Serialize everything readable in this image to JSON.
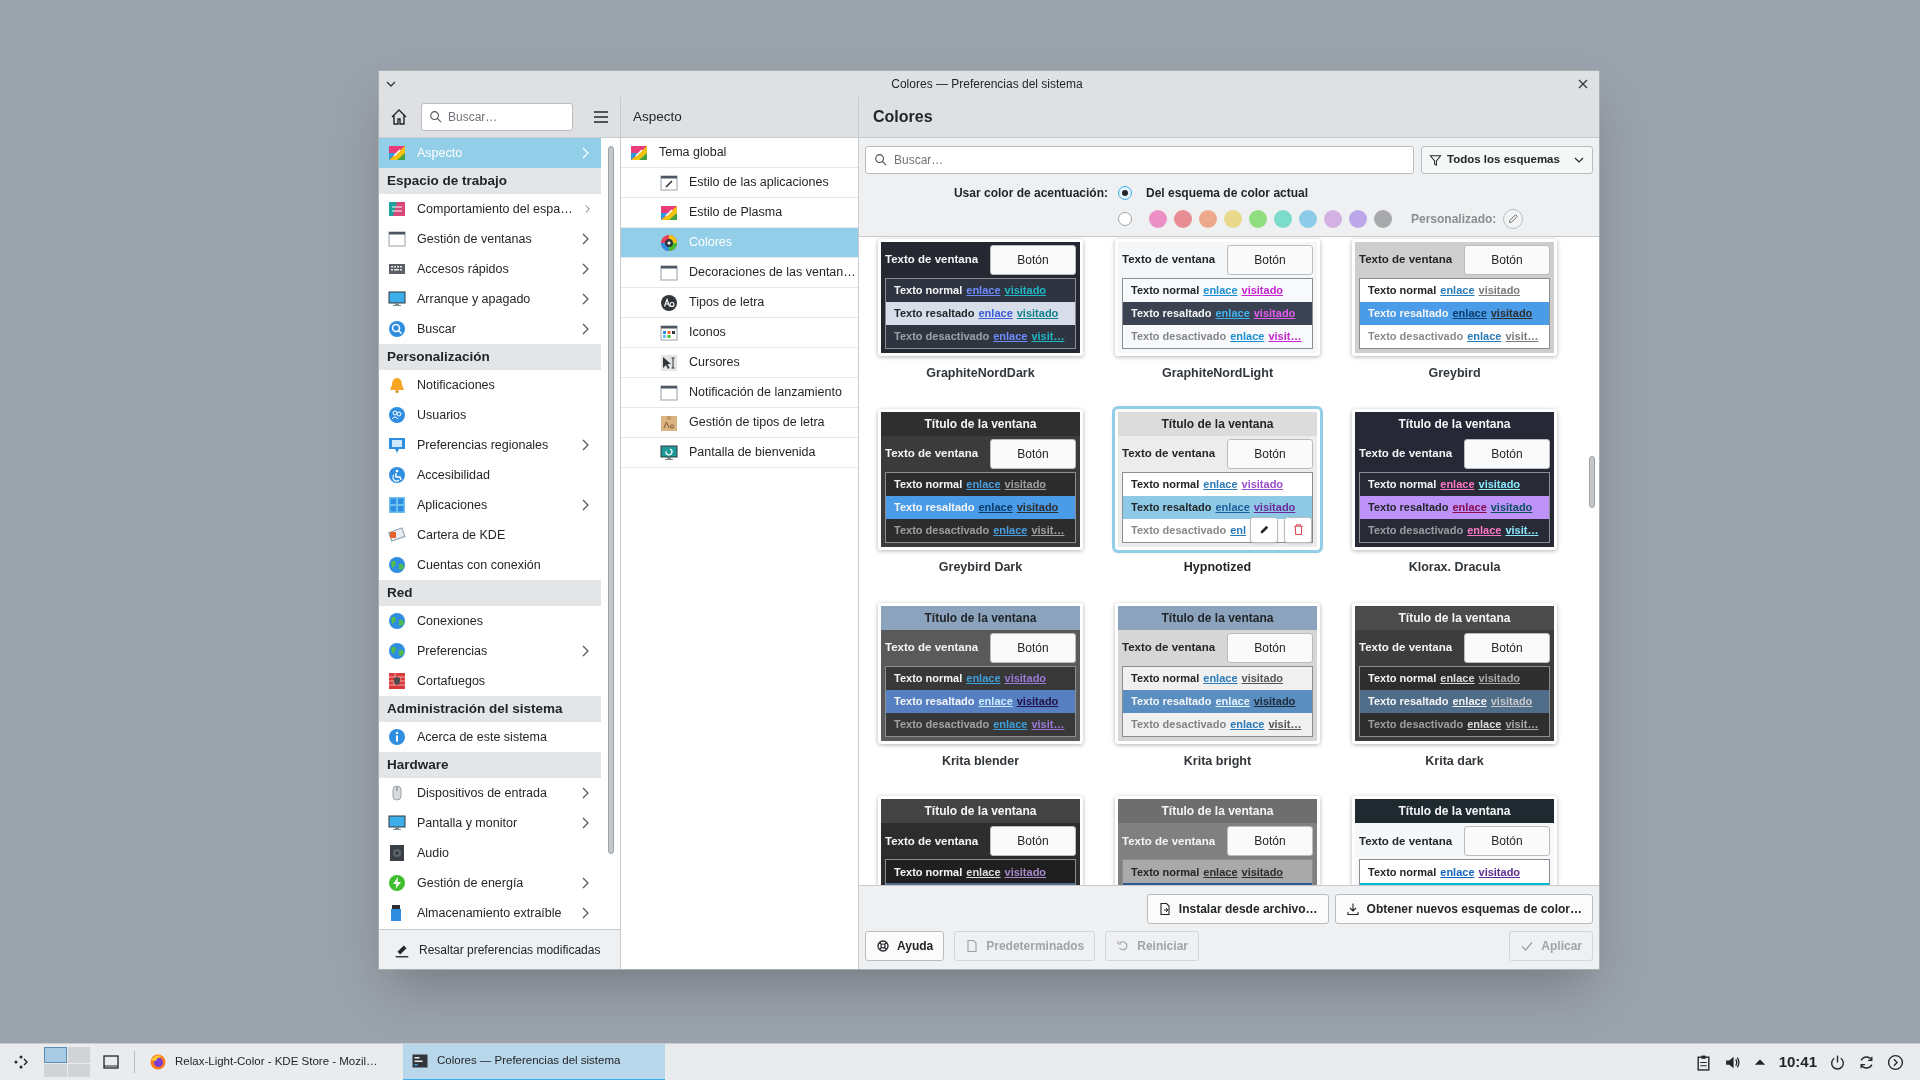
{
  "window": {
    "title": "Colores — Preferencias del sistema"
  },
  "sidebar": {
    "search": {
      "placeholder": "Buscar…"
    },
    "sections": [
      {
        "items": [
          {
            "label": "Aspecto",
            "selected": true,
            "has_children": true
          }
        ]
      },
      {
        "heading": "Espacio de trabajo",
        "items": [
          {
            "label": "Comportamiento del espa…",
            "selected": false,
            "has_children": true
          },
          {
            "label": "Gestión de ventanas",
            "selected": false,
            "has_children": true
          },
          {
            "label": "Accesos rápidos",
            "selected": false,
            "has_children": true
          },
          {
            "label": "Arranque y apagado",
            "selected": false,
            "has_children": true
          },
          {
            "label": "Buscar",
            "selected": false,
            "has_children": true
          }
        ]
      },
      {
        "heading": "Personalización",
        "items": [
          {
            "label": "Notificaciones",
            "selected": false,
            "has_children": false
          },
          {
            "label": "Usuarios",
            "selected": false,
            "has_children": false
          },
          {
            "label": "Preferencias regionales",
            "selected": false,
            "has_children": true
          },
          {
            "label": "Accesibilidad",
            "selected": false,
            "has_children": false
          },
          {
            "label": "Aplicaciones",
            "selected": false,
            "has_children": true
          },
          {
            "label": "Cartera de KDE",
            "selected": false,
            "has_children": false
          },
          {
            "label": "Cuentas con conexión",
            "selected": false,
            "has_children": false
          }
        ]
      },
      {
        "heading": "Red",
        "items": [
          {
            "label": "Conexiones",
            "selected": false,
            "has_children": false
          },
          {
            "label": "Preferencias",
            "selected": false,
            "has_children": true
          },
          {
            "label": "Cortafuegos",
            "selected": false,
            "has_children": false
          }
        ]
      },
      {
        "heading": "Administración del sistema",
        "items": [
          {
            "label": "Acerca de este sistema",
            "selected": false,
            "has_children": false
          }
        ]
      },
      {
        "heading": "Hardware",
        "items": [
          {
            "label": "Dispositivos de entrada",
            "selected": false,
            "has_children": true
          },
          {
            "label": "Pantalla y monitor",
            "selected": false,
            "has_children": true
          },
          {
            "label": "Audio",
            "selected": false,
            "has_children": false
          },
          {
            "label": "Gestión de energía",
            "selected": false,
            "has_children": true
          },
          {
            "label": "Almacenamiento extraíble",
            "selected": false,
            "has_children": true
          }
        ]
      }
    ],
    "footer_button": "Resaltar preferencias modificadas"
  },
  "category": {
    "title": "Aspecto",
    "items": [
      {
        "label": "Tema global",
        "selected": false,
        "children": [
          {
            "label": "Estilo de las aplicaciones",
            "selected": false
          },
          {
            "label": "Estilo de Plasma",
            "selected": false
          },
          {
            "label": "Colores",
            "selected": true
          },
          {
            "label": "Decoraciones de las ventan…",
            "selected": false
          },
          {
            "label": "Tipos de letra",
            "selected": false
          },
          {
            "label": "Iconos",
            "selected": false
          },
          {
            "label": "Cursores",
            "selected": false
          },
          {
            "label": "Notificación de lanzamiento",
            "selected": false
          },
          {
            "label": "Gestión de tipos de letra",
            "selected": false
          },
          {
            "label": "Pantalla de bienvenida",
            "selected": false
          }
        ]
      }
    ]
  },
  "page": {
    "title": "Colores",
    "search": {
      "placeholder": "Buscar…"
    },
    "filter": "Todos los esquemas",
    "accent": {
      "label": "Usar color de acentuación:",
      "from_scheme": {
        "label": "Del esquema de color actual",
        "selected": true
      },
      "palette_radio": {
        "selected": false
      },
      "swatches": [
        {
          "color": "#ec8fc4",
          "selected": false
        },
        {
          "color": "#e88d94",
          "selected": false
        },
        {
          "color": "#eda98b",
          "selected": false
        },
        {
          "color": "#e8d98c",
          "selected": false
        },
        {
          "color": "#90de7f",
          "selected": false
        },
        {
          "color": "#7bdccb",
          "selected": false
        },
        {
          "color": "#8ecbe8",
          "selected": false
        },
        {
          "color": "#d4b1e3",
          "selected": false
        },
        {
          "color": "#bba7ea",
          "selected": false
        },
        {
          "color": "#a8a9ab",
          "selected": false
        }
      ],
      "custom_label": "Personalizado:"
    },
    "schemes": [
      {
        "name": "GraphiteNordDark",
        "selected": false,
        "hovered": false,
        "window": {
          "color": "#252731",
          "text": "Texto de ventana",
          "button": "Botón"
        },
        "view": {
          "color": "#2e3440",
          "rows": [
            {
              "kind": "normal",
              "text": "Texto normal",
              "link": {
                "text": "enlace",
                "color": "#6f8cff"
              },
              "visited": {
                "text": "visitado",
                "color": "#1fb8c4"
              }
            },
            {
              "kind": "selected",
              "color": "#d8dee9",
              "text": "Texto resaltado",
              "link": {
                "text": "enlace",
                "color": "#3b5bdb"
              },
              "visited": {
                "text": "visitado",
                "color": "#0e7f8a"
              }
            },
            {
              "kind": "disabled",
              "text": "Texto desactivado",
              "link": {
                "text": "enlace",
                "color": "#6f8cff"
              },
              "visited": {
                "text": "visit…",
                "color": "#1fb8c4"
              }
            }
          ]
        }
      },
      {
        "name": "GraphiteNordLight",
        "selected": false,
        "hovered": false,
        "window": {
          "color": "#f5f6f8",
          "text": "Texto de ventana",
          "button": "Botón"
        },
        "view": {
          "color": "#f8f9fb",
          "rows": [
            {
              "kind": "normal",
              "text": "Texto normal",
              "link": {
                "text": "enlace",
                "color": "#1a8fd0"
              },
              "visited": {
                "text": "visitado",
                "color": "#c623d0"
              }
            },
            {
              "kind": "selected",
              "color": "#3b4252",
              "text": "Texto resaltado",
              "link": {
                "text": "enlace",
                "color": "#3fb4f0"
              },
              "visited": {
                "text": "visitado",
                "color": "#e55cf0"
              }
            },
            {
              "kind": "disabled",
              "text": "Texto desactivado",
              "link": {
                "text": "enlace",
                "color": "#1a8fd0"
              },
              "visited": {
                "text": "visit…",
                "color": "#c623d0"
              }
            }
          ]
        }
      },
      {
        "name": "Greybird",
        "selected": false,
        "hovered": false,
        "window": {
          "color": "#cecece",
          "text": "Texto de ventana",
          "button": "Botón"
        },
        "view": {
          "color": "#ffffff",
          "rows": [
            {
              "kind": "normal",
              "text": "Texto normal",
              "link": {
                "text": "enlace",
                "color": "#2a7ab8"
              },
              "visited": {
                "text": "visitado",
                "color": "#7a7a7a"
              }
            },
            {
              "kind": "selected",
              "color": "#4a9be8",
              "text": "Texto resaltado",
              "link": {
                "text": "enlace",
                "color": "#0b3d6b"
              },
              "visited": {
                "text": "visitado",
                "color": "#2e2e2e"
              }
            },
            {
              "kind": "disabled",
              "text": "Texto desactivado",
              "link": {
                "text": "enlace",
                "color": "#2a7ab8"
              },
              "visited": {
                "text": "visit…",
                "color": "#7a7a7a"
              }
            }
          ]
        }
      },
      {
        "name": "Greybird Dark",
        "selected": false,
        "hovered": false,
        "title": {
          "text": "Título de la ventana",
          "color": "#2f2f2f"
        },
        "window": {
          "color": "#3b3b3b",
          "text": "Texto de ventana",
          "button": "Botón"
        },
        "view": {
          "color": "#2c2c2c",
          "rows": [
            {
              "kind": "normal",
              "text": "Texto normal",
              "link": {
                "text": "enlace",
                "color": "#4a9fe0"
              },
              "visited": {
                "text": "visitado",
                "color": "#a0a0a0"
              }
            },
            {
              "kind": "selected",
              "color": "#4a9be8",
              "text": "Texto resaltado",
              "link": {
                "text": "enlace",
                "color": "#0b3d6b"
              },
              "visited": {
                "text": "visitado",
                "color": "#2e2e2e"
              }
            },
            {
              "kind": "disabled",
              "text": "Texto desactivado",
              "link": {
                "text": "enlace",
                "color": "#4a9fe0"
              },
              "visited": {
                "text": "visit…",
                "color": "#a0a0a0"
              }
            }
          ]
        }
      },
      {
        "name": "Hypnotized",
        "selected": true,
        "hovered": true,
        "title": {
          "text": "Título de la ventana",
          "color": "#dcdcdc"
        },
        "window": {
          "color": "#ececec",
          "text": "Texto de ventana",
          "button": "Botón"
        },
        "view": {
          "color": "#ffffff",
          "rows": [
            {
              "kind": "normal",
              "text": "Texto normal",
              "link": {
                "text": "enlace",
                "color": "#2a7ab8"
              },
              "visited": {
                "text": "visitado",
                "color": "#9b4dca"
              }
            },
            {
              "kind": "selected",
              "color": "#8ecae6",
              "text": "Texto resaltado",
              "link": {
                "text": "enlace",
                "color": "#1d5f99"
              },
              "visited": {
                "text": "visitado",
                "color": "#6a2a9a"
              }
            },
            {
              "kind": "disabled",
              "text": "Texto desactivado",
              "link": {
                "text": "enl",
                "color": "#2a7ab8"
              }
            }
          ]
        }
      },
      {
        "name": "Klorax. Dracula",
        "selected": false,
        "hovered": false,
        "title": {
          "text": "Título de la ventana",
          "color": "#262836"
        },
        "window": {
          "color": "#262836",
          "text": "Texto de ventana",
          "button": "Botón"
        },
        "view": {
          "color": "#282a36",
          "rows": [
            {
              "kind": "normal",
              "text": "Texto normal",
              "link": {
                "text": "enlace",
                "color": "#ff79c6"
              },
              "visited": {
                "text": "visitado",
                "color": "#8be9fd"
              }
            },
            {
              "kind": "selected",
              "color": "#bd93f9",
              "text": "Texto resaltado",
              "link": {
                "text": "enlace",
                "color": "#8a0a50"
              },
              "visited": {
                "text": "visitado",
                "color": "#0c4f5e"
              }
            },
            {
              "kind": "disabled",
              "text": "Texto desactivado",
              "link": {
                "text": "enlace",
                "color": "#ff79c6"
              },
              "visited": {
                "text": "visit…",
                "color": "#8be9fd"
              }
            }
          ]
        }
      },
      {
        "name": "Krita blender",
        "selected": false,
        "hovered": false,
        "title": {
          "text": "Título de la ventana",
          "color": "#8ba3bd"
        },
        "window": {
          "color": "#5a5a5a",
          "text": "Texto de ventana",
          "button": "Botón"
        },
        "view": {
          "color": "#383838",
          "rows": [
            {
              "kind": "normal",
              "text": "Texto normal",
              "link": {
                "text": "enlace",
                "color": "#3da0dc"
              },
              "visited": {
                "text": "visitado",
                "color": "#9a7ad5"
              }
            },
            {
              "kind": "selected",
              "color": "#5680c2",
              "text": "Texto resaltado",
              "link": {
                "text": "enlace",
                "color": "#c9ecff"
              },
              "visited": {
                "text": "visitado",
                "color": "#231048"
              }
            },
            {
              "kind": "disabled",
              "text": "Texto desactivado",
              "link": {
                "text": "enlace",
                "color": "#3da0dc"
              },
              "visited": {
                "text": "visit…",
                "color": "#9a7ad5"
              }
            }
          ]
        }
      },
      {
        "name": "Krita bright",
        "selected": false,
        "hovered": false,
        "title": {
          "text": "Título de la ventana",
          "color": "#8ba3bd"
        },
        "window": {
          "color": "#d6d6d6",
          "text": "Texto de ventana",
          "button": "Botón"
        },
        "view": {
          "color": "#f0f0f0",
          "rows": [
            {
              "kind": "normal",
              "text": "Texto normal",
              "link": {
                "text": "enlace",
                "color": "#2a7ab8"
              },
              "visited": {
                "text": "visitado",
                "color": "#555555"
              }
            },
            {
              "kind": "selected",
              "color": "#5a8ec0",
              "text": "Texto resaltado",
              "link": {
                "text": "enlace",
                "color": "#e8f4ff"
              },
              "visited": {
                "text": "visitado",
                "color": "#1c2a38"
              }
            },
            {
              "kind": "disabled",
              "text": "Texto desactivado",
              "link": {
                "text": "enlace",
                "color": "#2a7ab8"
              },
              "visited": {
                "text": "visit…",
                "color": "#555555"
              }
            }
          ]
        }
      },
      {
        "name": "Krita dark",
        "selected": false,
        "hovered": false,
        "title": {
          "text": "Título de la ventana",
          "color": "#4b4b4b"
        },
        "window": {
          "color": "#3d3d3d",
          "text": "Texto de ventana",
          "button": "Botón"
        },
        "view": {
          "color": "#2e2e2e",
          "rows": [
            {
              "kind": "normal",
              "text": "Texto normal",
              "link": {
                "text": "enlace",
                "color": "#dddddd"
              },
              "visited": {
                "text": "visitado",
                "color": "#aaaaaa"
              }
            },
            {
              "kind": "selected",
              "color": "#4f6c88",
              "text": "Texto resaltado",
              "link": {
                "text": "enlace",
                "color": "#f2f2f2"
              },
              "visited": {
                "text": "visitado",
                "color": "#c8c8c8"
              }
            },
            {
              "kind": "disabled",
              "text": "Texto desactivado",
              "link": {
                "text": "enlace",
                "color": "#dddddd"
              },
              "visited": {
                "text": "visit…",
                "color": "#aaaaaa"
              }
            }
          ]
        }
      },
      {
        "selected": false,
        "hovered": false,
        "title": {
          "text": "Título de la ventana",
          "color": "#444444"
        },
        "window": {
          "color": "#2d2d2d",
          "text": "Texto de ventana",
          "button": "Botón"
        },
        "view": {
          "color": "#1f1f1f",
          "rows": [
            {
              "kind": "normal",
              "text": "Texto normal",
              "link": {
                "text": "enlace",
                "color": "#dddddd"
              },
              "visited": {
                "text": "visitado",
                "color": "#a68acc"
              }
            },
            {
              "kind": "selected",
              "color": "#536d8c"
            }
          ]
        }
      },
      {
        "selected": false,
        "hovered": false,
        "title": {
          "text": "Título de la ventana",
          "color": "#6e6e6e"
        },
        "window": {
          "color": "#808080",
          "text": "Texto de ventana",
          "button": "Botón"
        },
        "view": {
          "color": "#a9a9a9",
          "rows": [
            {
              "kind": "normal",
              "text": "Texto normal",
              "link": {
                "text": "enlace",
                "color": "#2b2b2b"
              },
              "visited": {
                "text": "visitado",
                "color": "#2b2b2b"
              }
            },
            {
              "kind": "selected",
              "color": "#2c5a8f"
            }
          ]
        }
      },
      {
        "selected": false,
        "hovered": false,
        "title": {
          "text": "Título de la ventana",
          "color": "#1f2a30"
        },
        "window": {
          "color": "#f6f7f9",
          "text": "Texto de ventana",
          "button": "Botón"
        },
        "view": {
          "color": "#ffffff",
          "rows": [
            {
              "kind": "normal",
              "text": "Texto normal",
              "link": {
                "text": "enlace",
                "color": "#1565c0"
              },
              "visited": {
                "text": "visitado",
                "color": "#5b2c8f"
              }
            },
            {
              "kind": "selected",
              "color": "#00bcd4"
            }
          ]
        }
      }
    ],
    "actions": [
      {
        "label": "Instalar desde archivo…",
        "disabled": false
      },
      {
        "label": "Obtener nuevos esquemas de color…",
        "disabled": false
      }
    ],
    "buttons": [
      {
        "label": "Ayuda",
        "disabled": false
      },
      {
        "label": "Predeterminados",
        "disabled": true
      },
      {
        "label": "Reiniciar",
        "disabled": true
      },
      {
        "label": "Aplicar",
        "disabled": true
      }
    ]
  },
  "taskbar": {
    "desktops": [
      {
        "selected": true
      },
      {
        "selected": false
      },
      {
        "selected": false
      },
      {
        "selected": false
      }
    ],
    "tasks": [
      {
        "label": "Relax-Light-Color - KDE Store - Mozil…",
        "selected": false
      },
      {
        "label": "Colores — Preferencias del sistema",
        "selected": true
      }
    ],
    "clock": "10:41"
  }
}
